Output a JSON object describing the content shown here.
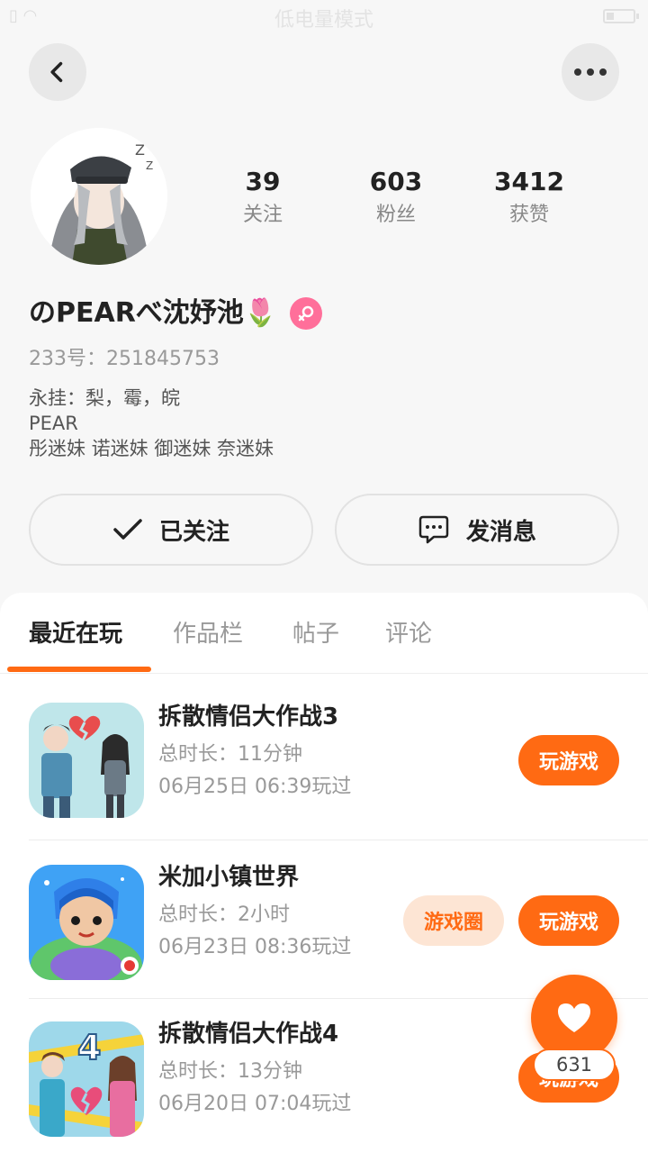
{
  "status_bar": {
    "mode_text": "低电量模式"
  },
  "header": {
    "back_icon": "chevron-left-icon",
    "more_icon": "more-dots-icon"
  },
  "profile": {
    "stats": [
      {
        "value": "39",
        "label": "关注"
      },
      {
        "value": "603",
        "label": "粉丝"
      },
      {
        "value": "3412",
        "label": "获赞"
      }
    ],
    "username": "のPEARべ沈妤池🌷",
    "gender_symbol": "♀",
    "uid": "233号：251845753",
    "bio_lines": [
      "永挂：梨，霉，皖",
      "PEAR",
      "彤迷妹 诺迷妹  御迷妹 奈迷妹"
    ]
  },
  "actions": {
    "following_label": "已关注",
    "message_label": "发消息"
  },
  "tabs": [
    {
      "label": "最近在玩",
      "active": true
    },
    {
      "label": "作品栏",
      "active": false
    },
    {
      "label": "帖子",
      "active": false
    },
    {
      "label": "评论",
      "active": false
    }
  ],
  "games": [
    {
      "name": "拆散情侣大作战3",
      "duration": "总时长：11分钟",
      "last_played": "06月25日 06:39玩过",
      "play_label": "玩游戏"
    },
    {
      "name": "米加小镇世界",
      "duration": "总时长：2小时",
      "last_played": "06月23日 08:36玩过",
      "play_label": "玩游戏",
      "circle_label": "游戏圈"
    },
    {
      "name": "拆散情侣大作战4",
      "duration": "总时长：13分钟",
      "last_played": "06月20日 07:04玩过",
      "play_label": "玩游戏"
    }
  ],
  "floating": {
    "like_count": "631",
    "icon": "heart-icon"
  },
  "colors": {
    "accent": "#ff6a13",
    "accent_light": "#fde5d4",
    "gender_pink": "#ff6f9a"
  }
}
